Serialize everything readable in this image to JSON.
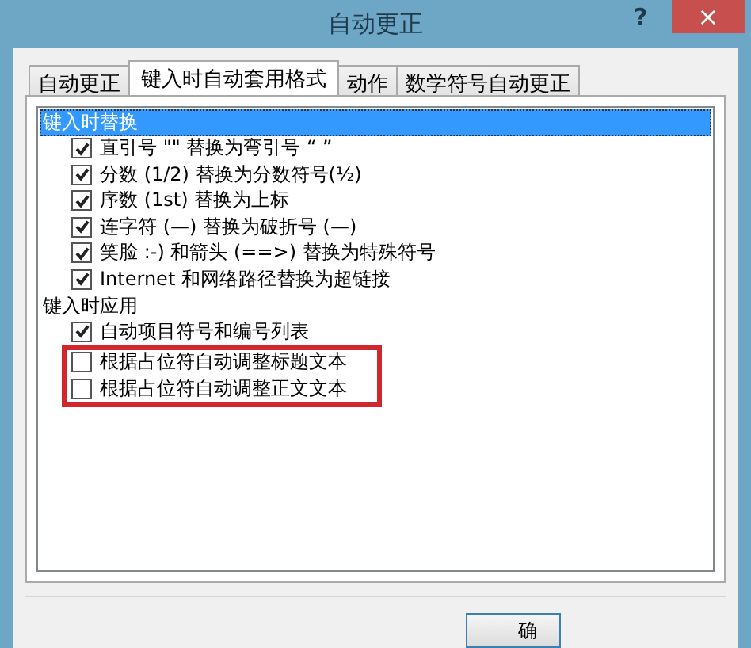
{
  "window": {
    "title": "自动更正",
    "help": "?",
    "close": "×"
  },
  "tabs": [
    {
      "label": "自动更正",
      "selected": false
    },
    {
      "label": "键入时自动套用格式",
      "selected": true
    },
    {
      "label": "动作",
      "selected": false
    },
    {
      "label": "数学符号自动更正",
      "selected": false
    }
  ],
  "list": {
    "items": [
      {
        "kind": "heading",
        "label": "键入时替换",
        "selected": true
      },
      {
        "kind": "checkbox",
        "label": "直引号 \"\" 替换为弯引号 “ ”",
        "checked": true,
        "highlighted": false
      },
      {
        "kind": "checkbox",
        "label": "分数 (1/2) 替换为分数符号(½)",
        "checked": true,
        "highlighted": false
      },
      {
        "kind": "checkbox",
        "label": "序数 (1st) 替换为上标",
        "checked": true,
        "highlighted": false
      },
      {
        "kind": "checkbox",
        "label": "连字符 (—) 替换为破折号 (—)",
        "checked": true,
        "highlighted": false
      },
      {
        "kind": "checkbox",
        "label": "笑脸 :-) 和箭头 (==>) 替换为特殊符号",
        "checked": true,
        "highlighted": false
      },
      {
        "kind": "checkbox",
        "label": "Internet 和网络路径替换为超链接",
        "checked": true,
        "highlighted": false
      },
      {
        "kind": "heading",
        "label": "键入时应用",
        "selected": false
      },
      {
        "kind": "checkbox",
        "label": "自动项目符号和编号列表",
        "checked": true,
        "highlighted": false
      },
      {
        "kind": "checkbox",
        "label": "根据占位符自动调整标题文本",
        "checked": false,
        "highlighted": true
      },
      {
        "kind": "checkbox",
        "label": "根据占位符自动调整正文文本",
        "checked": false,
        "highlighted": true
      }
    ]
  },
  "buttons": [
    {
      "label": "确"
    }
  ]
}
